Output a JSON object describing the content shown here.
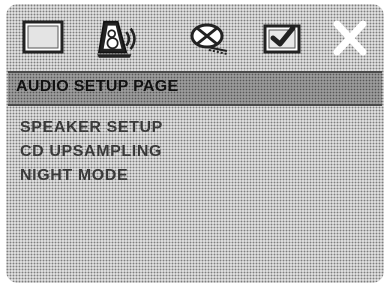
{
  "tabs": [
    {
      "icon": "general-setup-icon"
    },
    {
      "icon": "audio-setup-icon"
    },
    {
      "icon": "video-setup-icon"
    },
    {
      "icon": "preference-setup-icon"
    },
    {
      "icon": "exit-icon"
    }
  ],
  "active_tab": 1,
  "page_title": "AUDIO SETUP PAGE",
  "menu_items": [
    {
      "label": "SPEAKER SETUP"
    },
    {
      "label": "CD UPSAMPLING"
    },
    {
      "label": "NIGHT MODE"
    }
  ],
  "colors": {
    "background": "#cfcfcf",
    "title_bar": "#9a9a9a",
    "icon_stroke": "#222222",
    "icon_fill_light": "#ffffff",
    "text": "#3a3a3a"
  }
}
